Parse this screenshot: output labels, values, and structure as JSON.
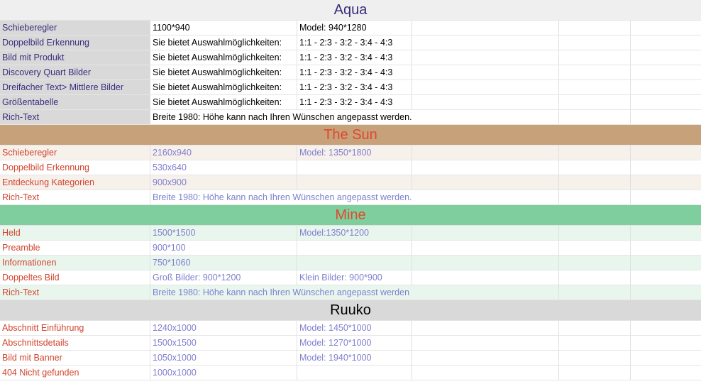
{
  "colors": {
    "aqua_header_bg": "#efefef",
    "aqua_title": "#3b2a7a",
    "aqua_label_bg": "#d9d9d9",
    "aqua_label_text": "#3a2d7d",
    "aqua_value_text": "#000000",
    "sun_header_bg": "#c6a17a",
    "sun_title": "#e0482f",
    "sun_row_alt_bg": "#f7f1ec",
    "sun_label_text": "#d2432c",
    "sun_value_text": "#7f7fcf",
    "mine_header_bg": "#7fcf9e",
    "mine_title": "#e0482f",
    "mine_row_alt_bg": "#e9f6ee",
    "mine_label_text": "#d2432c",
    "mine_value_text": "#7f7fcf",
    "ruuko_header_bg": "#d9d9d9",
    "ruuko_title": "#000000",
    "ruuko_label_text": "#d2432c",
    "ruuko_value_text": "#7f7fcf"
  },
  "sections": [
    {
      "title": "Aqua",
      "rows": [
        {
          "label": "Schieberegler",
          "v1": "1100*940",
          "v2": "Model: 940*1280"
        },
        {
          "label": "Doppelbild Erkennung",
          "v1": "Sie bietet Auswahlmöglichkeiten:",
          "v2": "1:1 - 2:3 - 3:2 - 3:4 - 4:3"
        },
        {
          "label": "Bild mit Produkt",
          "v1": "Sie bietet Auswahlmöglichkeiten:",
          "v2": "1:1 - 2:3 - 3:2 - 3:4 - 4:3"
        },
        {
          "label": "Discovery Quart Bilder",
          "v1": "Sie bietet Auswahlmöglichkeiten:",
          "v2": "1:1 - 2:3 - 3:2 - 3:4 - 4:3"
        },
        {
          "label": "Dreifacher Text> Mittlere Bilder",
          "v1": "Sie bietet Auswahlmöglichkeiten:",
          "v2": "1:1 - 2:3 - 3:2 - 3:4 - 4:3"
        },
        {
          "label": "Größentabelle",
          "v1": "Sie bietet Auswahlmöglichkeiten:",
          "v2": "1:1 - 2:3 - 3:2 - 3:4 - 4:3"
        },
        {
          "label": "Rich-Text",
          "v1": "Breite 1980: Höhe kann nach Ihren Wünschen angepasst werden.",
          "v2": ""
        }
      ]
    },
    {
      "title": "The Sun",
      "rows": [
        {
          "label": "Schieberegler",
          "v1": "2160x940",
          "v2": "Model: 1350*1800"
        },
        {
          "label": "Doppelbild Erkennung",
          "v1": "530x640",
          "v2": ""
        },
        {
          "label": "Entdeckung Kategorien",
          "v1": "900x900",
          "v2": ""
        },
        {
          "label": "Rich-Text",
          "v1": "Breite 1980: Höhe kann nach Ihren Wünschen angepasst werden.",
          "v2": ""
        }
      ]
    },
    {
      "title": "Mine",
      "rows": [
        {
          "label": "Held",
          "v1": "1500*1500",
          "v2": "Model:1350*1200"
        },
        {
          "label": "Preamble",
          "v1": "900*100",
          "v2": ""
        },
        {
          "label": "Informationen",
          "v1": "750*1060",
          "v2": ""
        },
        {
          "label": "Doppeltes Bild",
          "v1": "Groß Bilder: 900*1200",
          "v2": "Klein Bilder: 900*900"
        },
        {
          "label": "Rich-Text",
          "v1": "Breite 1980: Höhe kann nach Ihren Wünschen angepasst werden",
          "v2": ""
        }
      ]
    },
    {
      "title": "Ruuko",
      "rows": [
        {
          "label": "Abschnitt Einführung",
          "v1": "1240x1000",
          "v2": "Model: 1450*1000"
        },
        {
          "label": "Abschnittsdetails",
          "v1": "1500x1500",
          "v2": "Model: 1270*1000"
        },
        {
          "label": "Bild mit Banner",
          "v1": "1050x1000",
          "v2": "Model: 1940*1000"
        },
        {
          "label": "404 Nicht gefunden",
          "v1": "1000x1000",
          "v2": ""
        }
      ]
    }
  ]
}
